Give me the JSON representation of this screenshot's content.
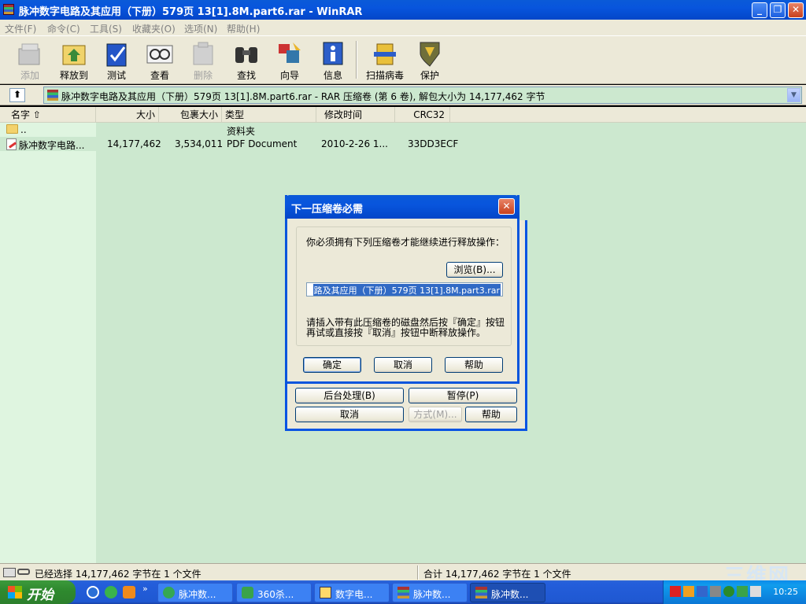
{
  "window": {
    "title": "脉冲数字电路及其应用（下册）579页 13[1].8M.part6.rar - WinRAR",
    "controls": {
      "minimize": "_",
      "maximize": "❐",
      "close": "✕"
    }
  },
  "menu": [
    "文件(F)",
    "命令(C)",
    "工具(S)",
    "收藏夹(O)",
    "选项(N)",
    "帮助(H)"
  ],
  "toolbar": {
    "add": "添加",
    "extract": "释放到",
    "test": "测试",
    "view": "查看",
    "delete": "删除",
    "find": "查找",
    "wizard": "向导",
    "info": "信息",
    "virus": "扫描病毒",
    "protect": "保护"
  },
  "address": {
    "up": "⬆",
    "text": "脉冲数字电路及其应用（下册）579页 13[1].8M.part6.rar - RAR 压缩卷 (第 6 卷), 解包大小为 14,177,462 字节",
    "dropdown": "▼"
  },
  "columns": {
    "name": "名字 ⇧",
    "size": "大小",
    "packed": "包裹大小",
    "type": "类型",
    "modified": "修改时间",
    "crc": "CRC32"
  },
  "rows": [
    {
      "name": "..",
      "size": "",
      "packed": "",
      "type": "资料夹",
      "modified": "",
      "crc": ""
    },
    {
      "name": "脉冲数字电路...",
      "size": "14,177,462",
      "packed": "3,534,011",
      "type": "PDF Document",
      "modified": "2010-2-26 1...",
      "crc": "33DD3ECF"
    }
  ],
  "dialog": {
    "title": "下一压缩卷必需",
    "close": "✕",
    "message": "你必须拥有下列压缩卷才能继续进行释放操作：",
    "browse": "浏览(B)...",
    "volume": "路及其应用（下册）579页 13[1].8M.part3.rar",
    "instruction1": "请插入带有此压缩卷的磁盘然后按『确定』按钮",
    "instruction2": "再试或直接按『取消』按钮中断释放操作。",
    "ok": "确定",
    "cancel": "取消",
    "help": "帮助"
  },
  "progress_dialog": {
    "background": "后台处理(B)",
    "pause": "暂停(P)",
    "cancel": "取消",
    "mode": "方式(M)...",
    "help": "帮助"
  },
  "status": {
    "left": "已经选择 14,177,462 字节在 1 个文件",
    "right": "合计 14,177,462 字节在 1 个文件"
  },
  "taskbar": {
    "start": "开始",
    "chevron": "»",
    "tasks": [
      "脉冲数...",
      "360杀...",
      "数字电...",
      "脉冲数...",
      "脉冲数..."
    ],
    "clock": "10:25"
  },
  "watermark": "三维网"
}
